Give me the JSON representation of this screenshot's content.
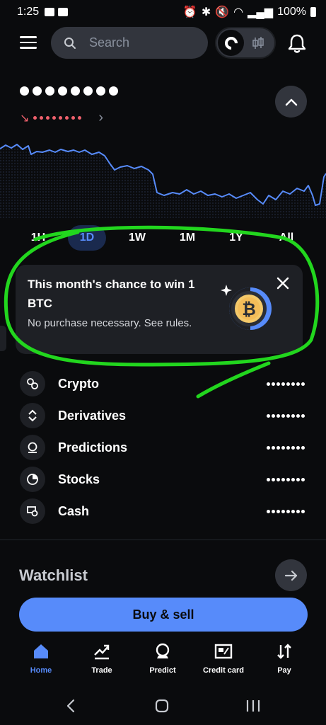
{
  "status": {
    "time": "1:25",
    "battery": "100%"
  },
  "search": {
    "placeholder": "Search"
  },
  "time_ranges": [
    {
      "label": "1H",
      "active": false
    },
    {
      "label": "1D",
      "active": true
    },
    {
      "label": "1W",
      "active": false
    },
    {
      "label": "1M",
      "active": false
    },
    {
      "label": "1Y",
      "active": false
    },
    {
      "label": "All",
      "active": false
    }
  ],
  "promo": {
    "title": "This month's chance to win 1 BTC",
    "subtitle": "No purchase necessary. See rules."
  },
  "assets": [
    {
      "label": "Crypto",
      "icon": "crypto-icon"
    },
    {
      "label": "Derivatives",
      "icon": "derivatives-icon"
    },
    {
      "label": "Predictions",
      "icon": "predictions-icon"
    },
    {
      "label": "Stocks",
      "icon": "stocks-icon"
    },
    {
      "label": "Cash",
      "icon": "cash-icon"
    }
  ],
  "watchlist": {
    "title": "Watchlist"
  },
  "buy_sell": {
    "label": "Buy & sell"
  },
  "tabs": [
    {
      "label": "Home",
      "icon": "home-icon",
      "active": true
    },
    {
      "label": "Trade",
      "icon": "trade-icon",
      "active": false
    },
    {
      "label": "Predict",
      "icon": "predict-icon",
      "active": false
    },
    {
      "label": "Credit card",
      "icon": "credit-card-icon",
      "active": false
    },
    {
      "label": "Pay",
      "icon": "pay-icon",
      "active": false
    }
  ],
  "colors": {
    "background": "#0a0b0d",
    "accent": "#578bfa",
    "negative": "#f0616d",
    "annotation": "#22d61e"
  }
}
